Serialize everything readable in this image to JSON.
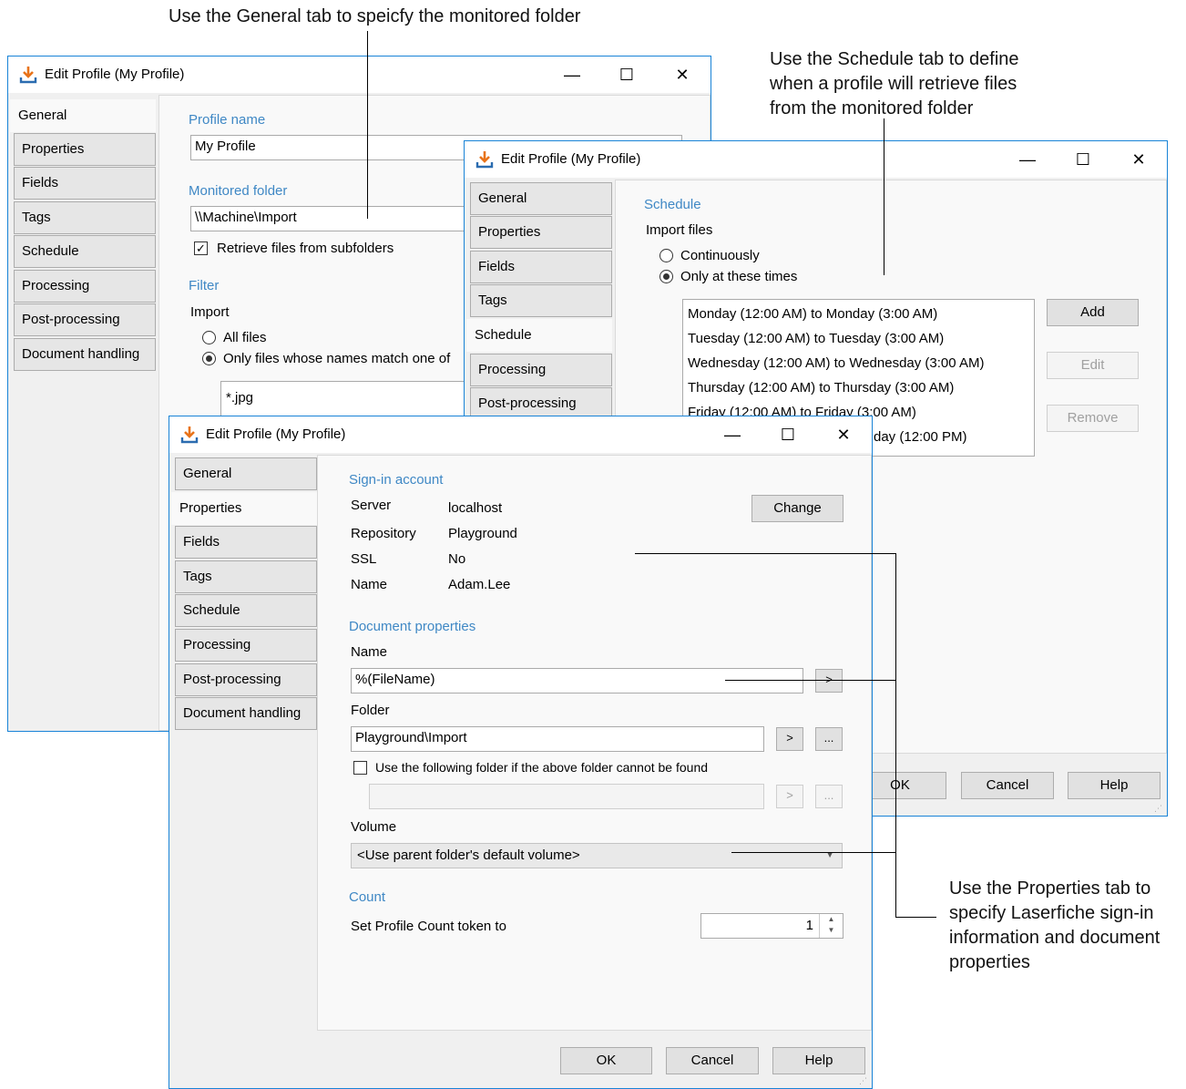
{
  "annotations": {
    "general": "Use the General tab to speicfy the monitored folder",
    "schedule": [
      "Use the Schedule tab to define",
      "when a profile will retrieve files",
      "from the monitored folder"
    ],
    "properties": [
      "Use the Properties tab to",
      "specify Laserfiche sign-in",
      "information and document",
      "properties"
    ]
  },
  "window_title": "Edit Profile (My Profile)",
  "tabs": [
    "General",
    "Properties",
    "Fields",
    "Tags",
    "Schedule",
    "Processing",
    "Post-processing",
    "Document handling"
  ],
  "general": {
    "profile_name_label": "Profile name",
    "profile_name_value": "My Profile",
    "monitored_folder_label": "Monitored folder",
    "monitored_folder_value": "\\\\Machine\\Import",
    "subfolders_label": "Retrieve files from subfolders",
    "filter_label": "Filter",
    "import_label": "Import",
    "all_files": "All files",
    "only_files": "Only files whose names match one of",
    "pattern": "*.jpg"
  },
  "schedule": {
    "section_label": "Schedule",
    "import_files": "Import files",
    "continuously": "Continuously",
    "only_times": "Only at these times",
    "times": [
      "Monday (12:00 AM) to Monday (3:00 AM)",
      "Tuesday (12:00 AM) to Tuesday (3:00 AM)",
      "Wednesday (12:00 AM) to Wednesday (3:00 AM)",
      "Thursday (12:00 AM) to Thursday (3:00 AM)",
      "Friday (12:00 AM) to Friday (3:00 AM)",
      "day (12:00 PM)"
    ],
    "add": "Add",
    "edit": "Edit",
    "remove": "Remove",
    "ok": "OK",
    "cancel": "Cancel",
    "help": "Help"
  },
  "properties": {
    "signin_label": "Sign-in account",
    "server_label": "Server",
    "server_value": "localhost",
    "repository_label": "Repository",
    "repository_value": "Playground",
    "ssl_label": "SSL",
    "ssl_value": "No",
    "name_label": "Name",
    "name_value": "Adam.Lee",
    "change": "Change",
    "docprops_label": "Document properties",
    "doc_name_label": "Name",
    "doc_name_value": "%(FileName)",
    "folder_label": "Folder",
    "folder_value": "Playground\\Import",
    "fallback_label": "Use the following folder if the above folder cannot be found",
    "volume_label": "Volume",
    "volume_value": "<Use parent folder's default volume>",
    "count_label": "Count",
    "count_token_label": "Set Profile Count token to",
    "count_value": "1",
    "ok": "OK",
    "cancel": "Cancel",
    "help": "Help",
    "arrow": ">",
    "ellipsis": "..."
  }
}
